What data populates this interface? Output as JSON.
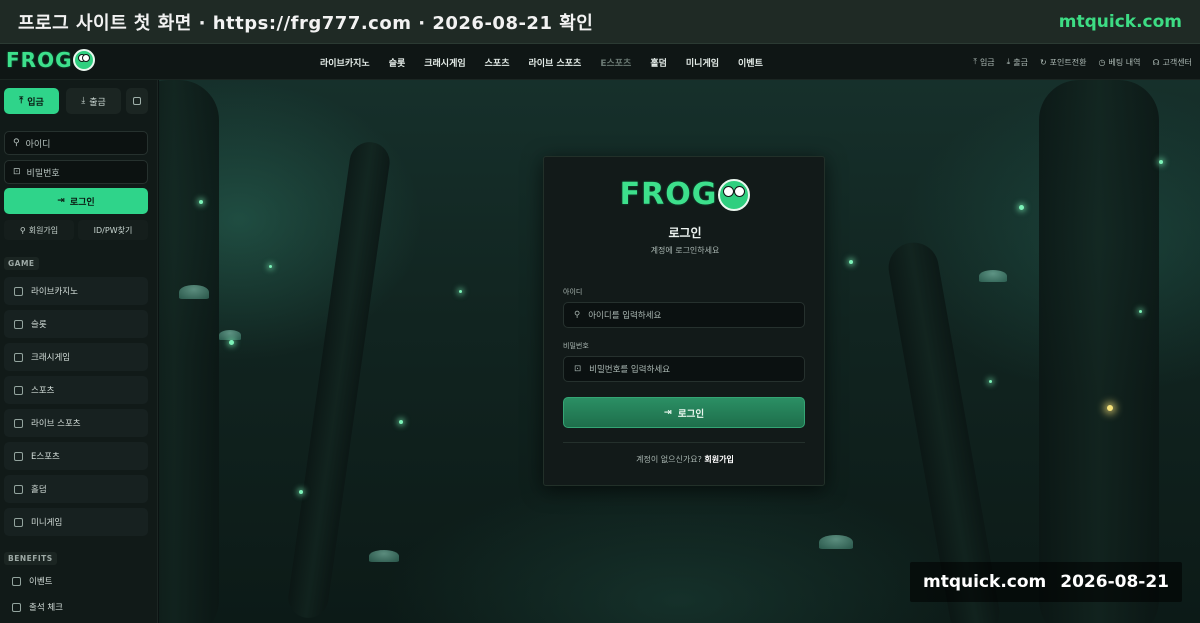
{
  "banner": {
    "title": "프로그 사이트 첫 화면   ·   https://frg777.com   ·   2026-08-21 확인",
    "site": "mtquick.com"
  },
  "brand": {
    "logo": "FROG"
  },
  "nav": {
    "items": [
      "라이브카지노",
      "슬롯",
      "크래시게임",
      "스포츠",
      "라이브 스포츠",
      "E스포츠",
      "홀덤",
      "미니게임",
      "이벤트"
    ],
    "right": [
      "입금",
      "출금",
      "포인트전환",
      "베팅 내역",
      "고객센터"
    ]
  },
  "sidebar": {
    "deposit": "입금",
    "withdraw": "출금",
    "id_placeholder": "아이디",
    "pw_placeholder": "비밀번호",
    "login": "로그인",
    "join": "회원가입",
    "find": "ID/PW찾기",
    "game_label": "GAME",
    "games": [
      "라이브카지노",
      "슬롯",
      "크래시게임",
      "스포츠",
      "라이브 스포츠",
      "E스포츠",
      "홀덤",
      "미니게임"
    ],
    "benefits_label": "BENEFITS",
    "benefits": [
      "이벤트",
      "출석 체크"
    ]
  },
  "login_card": {
    "logo": "FROG",
    "title": "로그인",
    "subtitle": "계정에 로그인하세요",
    "id_label": "아이디",
    "id_placeholder": "아이디를 입력하세요",
    "pw_label": "비밀번호",
    "pw_placeholder": "비밀번호를 입력하세요",
    "button": "로그인",
    "footer_text": "계정이 없으신가요?",
    "footer_link": "회원가입"
  },
  "watermark": {
    "site": "mtquick.com",
    "date": "2026-08-21"
  },
  "colors": {
    "accent": "#2fd48a",
    "background": "#0b1212",
    "banner": "#1f2a25"
  }
}
